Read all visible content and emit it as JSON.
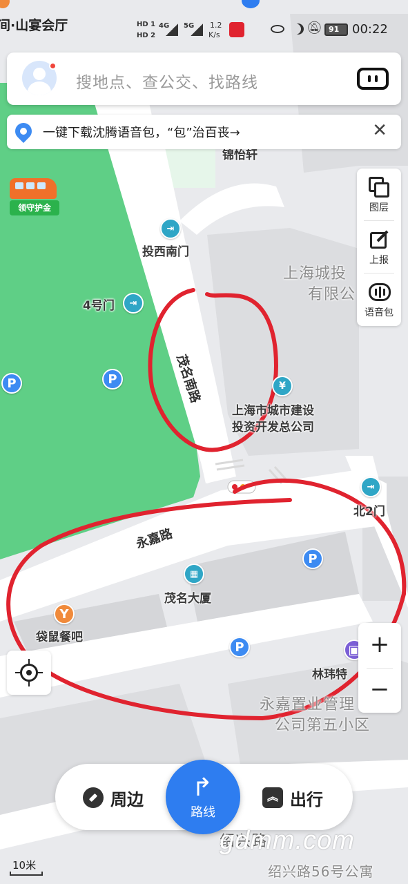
{
  "status_bar": {
    "location_chip": "间·山宴会厅",
    "sim1": "HD 1",
    "sim2": "HD 2",
    "net1": "4G",
    "net2": "5G",
    "speed_value": "1.2",
    "speed_unit": "K/s",
    "battery": "91",
    "time": "00:22"
  },
  "search": {
    "placeholder": "搜地点、查公交、找路线"
  },
  "banner": {
    "text": "一键下载沈腾语音包，“包”治百丧→",
    "close": "✕"
  },
  "promo": {
    "tag": "领守护金"
  },
  "tools": {
    "layers": "图层",
    "report": "上报",
    "voice_pack": "语音包"
  },
  "map": {
    "poi_top": "锦怡轩",
    "poi_west_gate": "投西南门",
    "poi_gate4": "4号门",
    "area_upper_right_1": "上海城投",
    "area_upper_right_2": "有限公",
    "road_maoming": "茂名南路",
    "poi_company_1": "上海市城市建设",
    "poi_company_2": "投资开发总公司",
    "poi_north_gate": "北2门",
    "road_yongjia": "永嘉路",
    "poi_building": "茂名大厦",
    "poi_restaurant": "袋鼠餐吧",
    "poi_linwei": "林玮特",
    "area_lower_1": "永嘉置业管理",
    "area_lower_2": "公司第五小区",
    "poi_bottom_partial": "绍兴路",
    "bottom_right_label": "绍兴路56号公寓",
    "parking_symbol": "P"
  },
  "controls": {
    "zoom_in": "+",
    "zoom_out": "−"
  },
  "bottom_nav": {
    "nearby": "周边",
    "route": "路线",
    "travel": "出行"
  },
  "scale": "10米",
  "watermark": "gdmm.com",
  "colors": {
    "green_area": "#5fcf86",
    "road": "#ffffff",
    "block": "#dfe0e3",
    "annotation": "#e0232f",
    "accent": "#2e7df0"
  }
}
